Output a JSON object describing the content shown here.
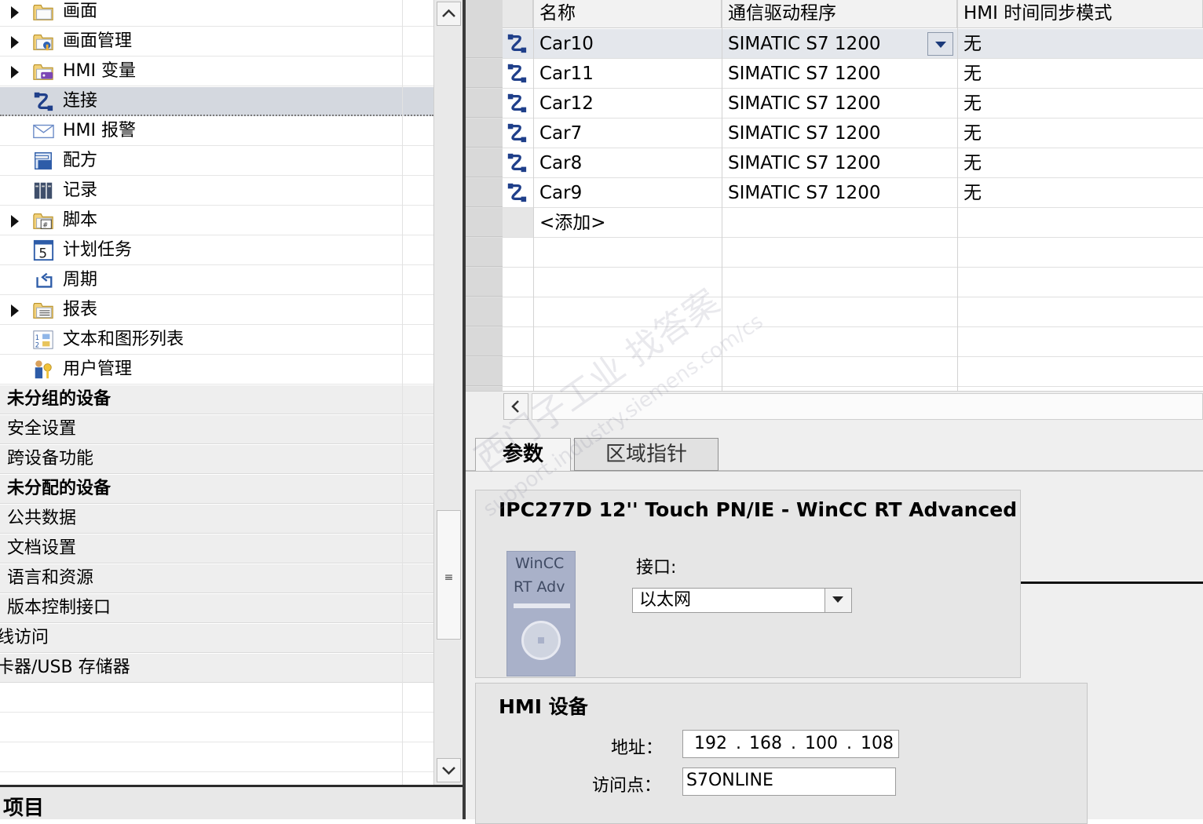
{
  "tree": {
    "items": [
      {
        "label": "画面",
        "icon": "folder-screens-icon",
        "expandable": true
      },
      {
        "label": "画面管理",
        "icon": "folder-screen-management-icon",
        "expandable": true
      },
      {
        "label": "HMI 变量",
        "icon": "folder-hmi-tags-icon",
        "expandable": true
      },
      {
        "label": "连接",
        "icon": "connection-icon",
        "expandable": false,
        "selected": true
      },
      {
        "label": "HMI 报警",
        "icon": "envelope-alarm-icon",
        "expandable": false
      },
      {
        "label": "配方",
        "icon": "recipe-icon",
        "expandable": false
      },
      {
        "label": "记录",
        "icon": "log-archive-icon",
        "expandable": false
      },
      {
        "label": "脚本",
        "icon": "folder-script-icon",
        "expandable": true
      },
      {
        "label": "计划任务",
        "icon": "scheduler-calendar-icon",
        "expandable": false
      },
      {
        "label": "周期",
        "icon": "cycle-icon",
        "expandable": false
      },
      {
        "label": "报表",
        "icon": "folder-report-icon",
        "expandable": true
      },
      {
        "label": "文本和图形列表",
        "icon": "text-graphic-list-icon",
        "expandable": false
      },
      {
        "label": "用户管理",
        "icon": "user-key-icon",
        "expandable": false
      }
    ],
    "groups": [
      {
        "label": "未分组的设备",
        "bold": true
      },
      {
        "label": "安全设置",
        "bold": false
      },
      {
        "label": "跨设备功能",
        "bold": false
      },
      {
        "label": "未分配的设备",
        "bold": true
      },
      {
        "label": "公共数据",
        "bold": false
      },
      {
        "label": "文档设置",
        "bold": false
      },
      {
        "label": "语言和资源",
        "bold": false
      },
      {
        "label": "版本控制接口",
        "bold": false
      },
      {
        "label": "线访问",
        "bold": false
      },
      {
        "label": "卡器/USB 存储器",
        "bold": false
      }
    ]
  },
  "bottom_bar": {
    "label": "项目"
  },
  "table": {
    "headers": [
      "名称",
      "通信驱动程序",
      "HMI 时间同步模式"
    ],
    "rows": [
      {
        "name": "Car10",
        "driver": "SIMATIC S7 1200",
        "sync": "无"
      },
      {
        "name": "Car11",
        "driver": "SIMATIC S7 1200",
        "sync": "无"
      },
      {
        "name": "Car12",
        "driver": "SIMATIC S7 1200",
        "sync": "无"
      },
      {
        "name": "Car7",
        "driver": "SIMATIC S7 1200",
        "sync": "无"
      },
      {
        "name": "Car8",
        "driver": "SIMATIC S7 1200",
        "sync": "无"
      },
      {
        "name": "Car9",
        "driver": "SIMATIC S7 1200",
        "sync": "无"
      }
    ],
    "add_label": "<添加>"
  },
  "tabs": {
    "params": "参数",
    "areas": "区域指针"
  },
  "device": {
    "title": "IPC277D 12'' Touch PN/IE - WinCC RT Advanced",
    "image_line1": "WinCC",
    "image_line2": "RT Adv",
    "interface_label": "接口:",
    "interface_value": "以太网"
  },
  "hmi": {
    "title": "HMI 设备",
    "address_label": "地址：",
    "address": [
      "192",
      "168",
      "100",
      "108"
    ],
    "address_dot": ".",
    "access_point_label": "访问点：",
    "access_point": "S7ONLINE"
  },
  "watermark": {
    "line1": "西门子工业  找答案",
    "line2": "support.industry.siemens.com/cs"
  },
  "colors": {
    "selected_row": "#d4d8df",
    "active_row": "#e4e7ec",
    "icon_blue": "#1f3f8a",
    "splitter": "#3a3a3a"
  }
}
